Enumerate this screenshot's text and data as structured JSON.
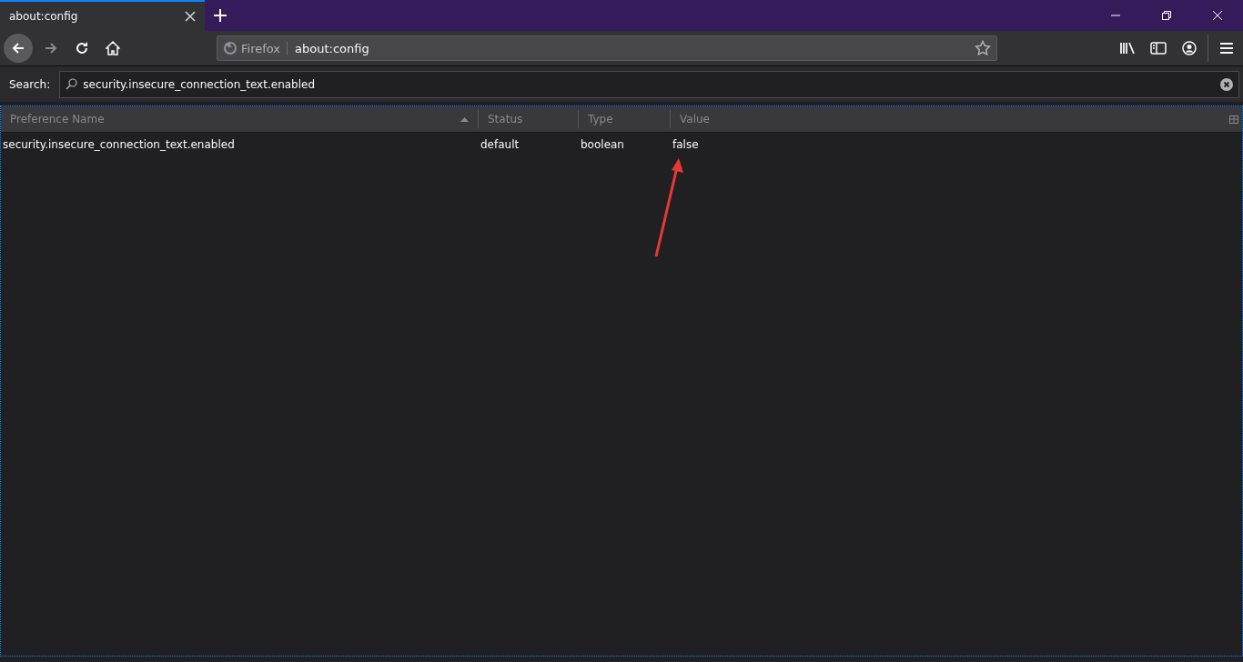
{
  "tabs": [
    {
      "label": "about:config",
      "selected": true
    }
  ],
  "address_bar": {
    "identity": "Firefox",
    "url": "about:config"
  },
  "search": {
    "label": "Search:",
    "value": "security.insecure_connection_text.enabled"
  },
  "table": {
    "columns": [
      {
        "label": "Preference Name",
        "sorted": true
      },
      {
        "label": "Status",
        "sorted": false
      },
      {
        "label": "Type",
        "sorted": false
      },
      {
        "label": "Value",
        "sorted": false
      }
    ],
    "rows": [
      {
        "cells": [
          "security.insecure_connection_text.enabled",
          "default",
          "boolean",
          "false"
        ]
      }
    ]
  }
}
